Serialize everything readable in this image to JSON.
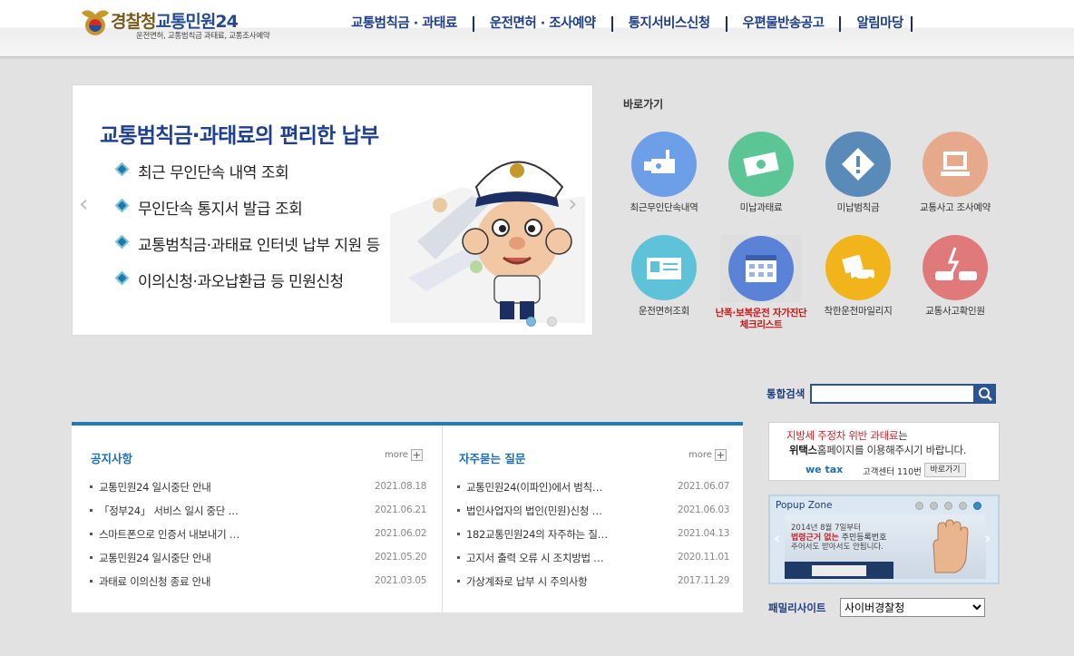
{
  "header": {
    "logo_title_1": "경찰청",
    "logo_title_2": "교통민원24",
    "logo_subtitle": "운전면허, 교통범칙금 과태료, 교통조사예약",
    "nav": [
      {
        "label": "교통범칙금 · 과태료"
      },
      {
        "label": "운전면허 · 조사예약"
      },
      {
        "label": "통지서비스신청"
      },
      {
        "label": "우편물반송공고"
      },
      {
        "label": "알림마당"
      }
    ]
  },
  "banner": {
    "title": "교통범칙금·과태료의 편리한 납부",
    "items": [
      {
        "text": "최근 무인단속 내역 조회"
      },
      {
        "text": "무인단속 통지서 발급 조회"
      },
      {
        "text": "교통범칙금·과태료 인터넷 납부 지원 등"
      },
      {
        "text": "이의신청·과오납환급 등 민원신청"
      }
    ],
    "arrow_left": "‹",
    "arrow_right": "›",
    "slide_count": 2,
    "active_slide": 1
  },
  "quick": {
    "title": "바로가기",
    "items": [
      {
        "label": "최근무인단속내역",
        "icon": "camera-icon",
        "color": "#6d9ee8"
      },
      {
        "label": "미납과태료",
        "icon": "money-icon",
        "color": "#5cc596"
      },
      {
        "label": "미납범칙금",
        "icon": "warning-icon",
        "color": "#5a8ab7"
      },
      {
        "label": "교통사고 조사예약",
        "icon": "computer-icon",
        "color": "#e6a98c"
      },
      {
        "label": "운전면허조회",
        "icon": "license-card-icon",
        "color": "#5ec2d8"
      },
      {
        "label": "난폭·보복운전 자가진단 체크리스트",
        "icon": "calendar-checklist-icon",
        "color": "#5a82d6"
      },
      {
        "label": "착한운전마일리지",
        "icon": "mileage-car-icon",
        "color": "#f2b41b"
      },
      {
        "label": "교통사고확인원",
        "icon": "car-accident-icon",
        "color": "#e07a7a"
      }
    ]
  },
  "search": {
    "label": "통합검색",
    "value": ""
  },
  "notice": {
    "title": "공지사항",
    "more": "more",
    "items": [
      {
        "subject": "교통민원24 일시중단 안내",
        "date": "2021.08.18"
      },
      {
        "subject": "「정부24」 서비스 일시 중단 …",
        "date": "2021.06.21"
      },
      {
        "subject": "스마트폰으로 인증서 내보내기 …",
        "date": "2021.06.02"
      },
      {
        "subject": "교통민원24 일시중단 안내",
        "date": "2021.05.20"
      },
      {
        "subject": "과태료 이의신청 종료 안내",
        "date": "2021.03.05"
      }
    ]
  },
  "faq": {
    "title": "자주묻는 질문",
    "more": "more",
    "items": [
      {
        "subject": "교통민원24(이파인)에서 범칙…",
        "date": "2021.06.07"
      },
      {
        "subject": "법인사업자의 법인(민원)신청 …",
        "date": "2021.06.03"
      },
      {
        "subject": "182교통민원24의 자주하는 질…",
        "date": "2021.04.13"
      },
      {
        "subject": "고지서 출력 오류 시 조치방법 …",
        "date": "2020.11.01"
      },
      {
        "subject": "가상계좌로 납부 시 주의사항",
        "date": "2017.11.29"
      }
    ]
  },
  "wetax": {
    "line1_red": "지방세 주정차 위반 과태료",
    "line1_rest": "는",
    "line2_bold": "위택스",
    "line2_rest": "홈페이지를 이용해주시기 바랍니다.",
    "logo": "we tax",
    "center": "고객센터 110번",
    "button": "바로가기"
  },
  "popup": {
    "title": "Popup Zone",
    "slide_count": 5,
    "active_slide": 5,
    "line1": "2014년 8월 7일부터",
    "line2_red": "법령근거 없는",
    "line2_rest": " 주민등록번호",
    "line3": "주어서도 받아서도 안됩니다.",
    "arrow_left": "‹",
    "arrow_right": "›"
  },
  "family": {
    "label": "패밀리사이트",
    "selected": "사이버경찰청"
  }
}
